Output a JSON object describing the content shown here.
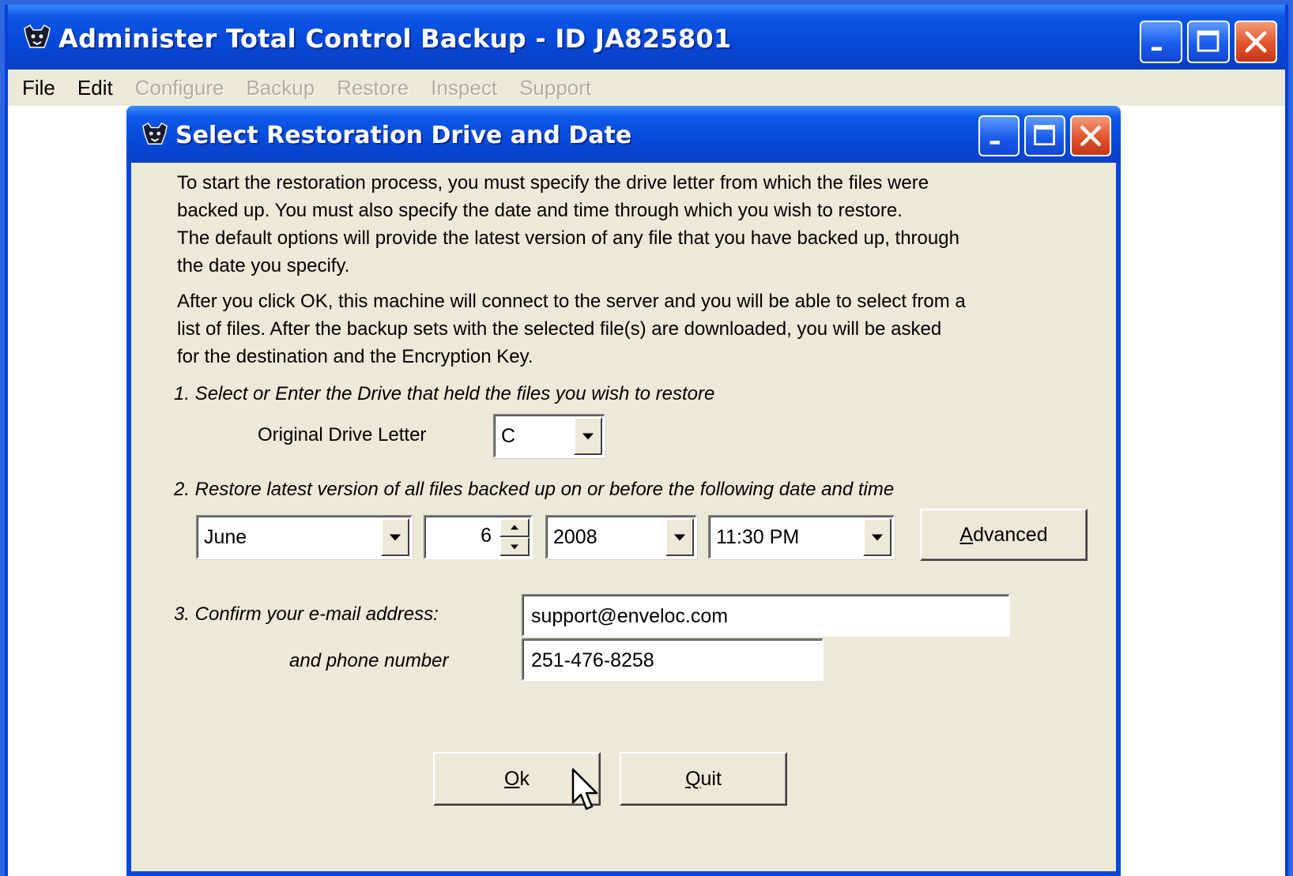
{
  "main_window": {
    "title": "Administer Total Control Backup - ID JA825801",
    "menu": [
      {
        "label": "File",
        "enabled": true
      },
      {
        "label": "Edit",
        "enabled": true
      },
      {
        "label": "Configure",
        "enabled": false
      },
      {
        "label": "Backup",
        "enabled": false
      },
      {
        "label": "Restore",
        "enabled": false
      },
      {
        "label": "Inspect",
        "enabled": false
      },
      {
        "label": "Support",
        "enabled": false
      }
    ]
  },
  "dialog": {
    "title": "Select Restoration Drive and Date",
    "intro_paragraph_1_lines": [
      "To start the restoration process, you must specify the drive letter from which the files were",
      "backed up.  You must also specify the date and time through which you wish to restore.",
      "The default options will provide the latest version of any file that you have backed up, through",
      "the date you specify."
    ],
    "intro_paragraph_2_lines": [
      "After you click OK, this machine will connect to the server and you will be able to select from a",
      "list of files.  After the backup sets with the selected file(s) are downloaded,  you will be asked",
      "for the destination and the Encryption Key."
    ],
    "step1": {
      "text": "1. Select or Enter the Drive that held the files you wish to restore",
      "drive_label": "Original Drive Letter",
      "drive_value": "C"
    },
    "step2": {
      "text": "2. Restore latest version of all files backed up on or before the following date and time",
      "month": "June",
      "day": "6",
      "year": "2008",
      "time": "11:30 PM",
      "advanced_accel": "A",
      "advanced_rest": "dvanced"
    },
    "step3": {
      "text": "3. Confirm your e-mail address:",
      "email": "support@enveloc.com",
      "phone_label": "and phone number",
      "phone": "251-476-8258"
    },
    "ok_accel": "O",
    "ok_rest": "k",
    "quit_accel": "Q",
    "quit_rest": "uit"
  },
  "colors": {
    "titlebar_blue": "#0648d8",
    "dialog_face": "#ece9d8",
    "desktop": "#2f66e0",
    "close_red": "#e2542c"
  }
}
